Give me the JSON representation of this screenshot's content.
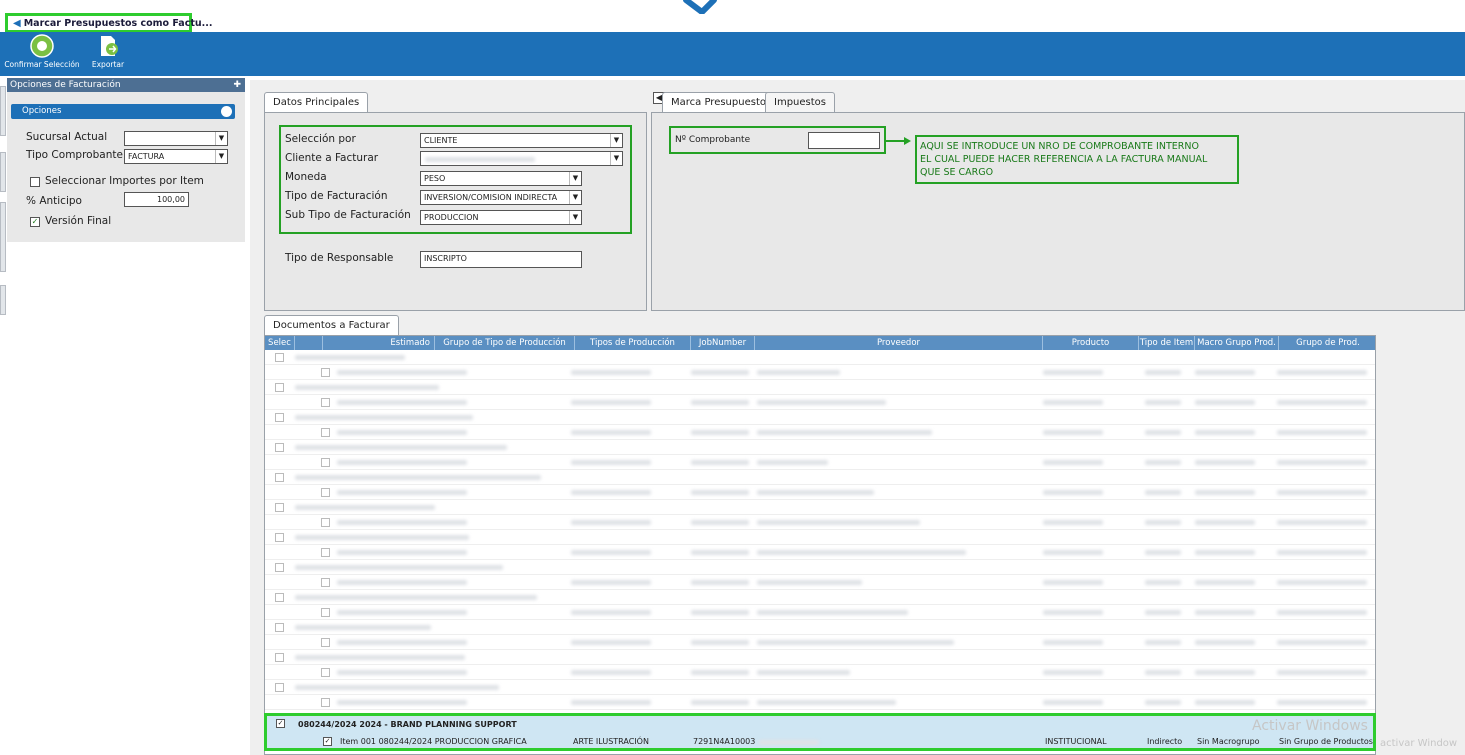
{
  "window": {
    "tab_title": "Marcar Presupuestos como Factu..."
  },
  "toolbar": {
    "confirm_label": "Confirmar Selección",
    "export_label": "Exportar"
  },
  "left": {
    "header": "Opciones de Facturación",
    "group": "Opciones",
    "sucursal_label": "Sucursal Actual",
    "sucursal_value": "",
    "tipo_label": "Tipo Comprobante",
    "tipo_value": "FACTURA",
    "sel_importes_label": "Seleccionar Importes por Item",
    "sel_importes_checked": false,
    "anticipo_label": "% Anticipo",
    "anticipo_value": "100,00",
    "version_label": "Versión Final",
    "version_checked": true
  },
  "datos": {
    "tab": "Datos Principales",
    "seleccion_label": "Selección por",
    "seleccion_value": "CLIENTE",
    "cliente_label": "Cliente a Facturar",
    "moneda_label": "Moneda",
    "moneda_value": "PESO",
    "tipo_fact_label": "Tipo de Facturación",
    "tipo_fact_value": "INVERSION/COMISION INDIRECTA",
    "subtipo_label": "Sub Tipo de Facturación",
    "subtipo_value": "PRODUCCION",
    "responsable_label": "Tipo de Responsable",
    "responsable_value": "INSCRIPTO"
  },
  "marca": {
    "tab_marca": "Marca Presupuestos",
    "tab_impuestos": "Impuestos",
    "comprobante_label": "Nº Comprobante",
    "comprobante_value": "",
    "note_lines": [
      "AQUI SE INTRODUCE UN NRO DE COMPROBANTE INTERNO",
      "EL CUAL PUEDE HACER REFERENCIA A LA FACTURA MANUAL",
      "QUE SE CARGO"
    ]
  },
  "documentos": {
    "tab": "Documentos a Facturar",
    "columns": [
      "Selec",
      "Estimado",
      "Grupo de Tipo de Producción",
      "Tipos de Producción",
      "JobNumber",
      "Proveedor",
      "Producto",
      "Tipo de Item",
      "Macro Grupo Prod.",
      "Grupo de Prod."
    ],
    "selected_group": {
      "label": "080244/2024 2024 - BRAND PLANNING SUPPORT",
      "checked": true
    },
    "selected_item": {
      "label": "Item 001 080244/2024 PRODUCCION GRAFICA",
      "checked": true,
      "tipos": "ARTE ILUSTRACIÓN",
      "job": "7291N4A10003",
      "producto": "INSTITUCIONAL",
      "tipo_item": "Indirecto",
      "macro": "Sin Macrogrupo",
      "grupo": "Sin Grupo de Productos"
    }
  },
  "watermark": {
    "line1": "Activar Windows",
    "line2": "activar Window"
  },
  "colors": {
    "toolbar": "#1d70b7",
    "highlight": "#2ecc2e",
    "header": "#5a8fc2"
  }
}
